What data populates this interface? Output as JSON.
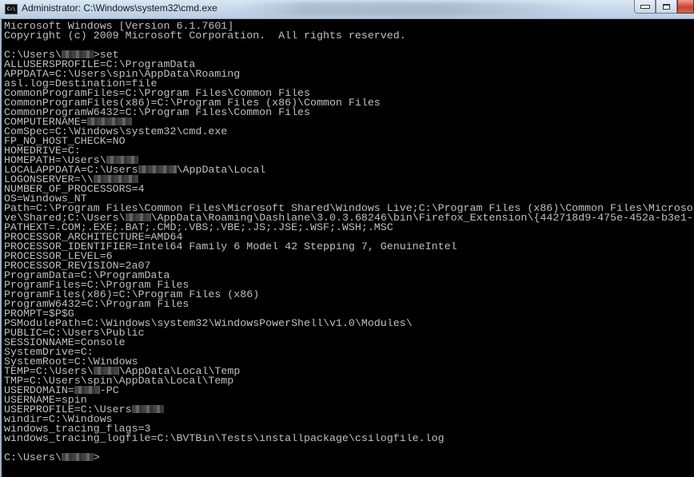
{
  "window": {
    "title": "Administrator: C:\\Windows\\system32\\cmd.exe",
    "icon": "cmd-icon",
    "buttons": [
      "minimize",
      "maximize",
      "close"
    ]
  },
  "console": {
    "lines": [
      {
        "text": "Microsoft Windows [Version 6.1.7601]"
      },
      {
        "text": "Copyright (c) 2009 Microsoft Corporation.  All rights reserved."
      },
      {
        "text": ""
      },
      {
        "text": "C:\\Users\\",
        "redacted": 5,
        "after": ">set"
      },
      {
        "text": "ALLUSERSPROFILE=C:\\ProgramData"
      },
      {
        "text": "APPDATA=C:\\Users\\spin\\AppData\\Roaming"
      },
      {
        "text": "asl.log=Destination=file"
      },
      {
        "text": "CommonProgramFiles=C:\\Program Files\\Common Files"
      },
      {
        "text": "CommonProgramFiles(x86)=C:\\Program Files (x86)\\Common Files"
      },
      {
        "text": "CommonProgramW6432=C:\\Program Files\\Common Files"
      },
      {
        "text": "COMPUTERNAME=",
        "redacted": 7,
        "after": ""
      },
      {
        "text": "ComSpec=C:\\Windows\\system32\\cmd.exe"
      },
      {
        "text": "FP_NO_HOST_CHECK=NO"
      },
      {
        "text": "HOMEDRIVE=C:"
      },
      {
        "text": "HOMEPATH=\\Users\\",
        "redacted": 5,
        "after": ""
      },
      {
        "text": "LOCALAPPDATA=C:\\Users",
        "redacted": 6,
        "after": "\\AppData\\Local"
      },
      {
        "text": "LOGONSERVER=\\\\",
        "redacted": 7,
        "after": ""
      },
      {
        "text": "NUMBER_OF_PROCESSORS=4"
      },
      {
        "text": "OS=Windows_NT"
      },
      {
        "text": "Path=C:\\Program Files\\Common Files\\Microsoft Shared\\Windows Live;C:\\Program Files (x86)\\Common Files\\Microso"
      },
      {
        "text": "ve\\Shared;C:\\Users\\",
        "redacted": 4,
        "after": "\\AppData\\Roaming\\Dashlane\\3.0.3.68246\\bin\\Firefox_Extension\\{442718d9-475e-452a-b3e1-"
      },
      {
        "text": "PATHEXT=.COM;.EXE;.BAT;.CMD;.VBS;.VBE;.JS;.JSE;.WSF;.WSH;.MSC"
      },
      {
        "text": "PROCESSOR_ARCHITECTURE=AMD64"
      },
      {
        "text": "PROCESSOR_IDENTIFIER=Intel64 Family 6 Model 42 Stepping 7, GenuineIntel"
      },
      {
        "text": "PROCESSOR_LEVEL=6"
      },
      {
        "text": "PROCESSOR_REVISION=2a07"
      },
      {
        "text": "ProgramData=C:\\ProgramData"
      },
      {
        "text": "ProgramFiles=C:\\Program Files"
      },
      {
        "text": "ProgramFiles(x86)=C:\\Program Files (x86)"
      },
      {
        "text": "ProgramW6432=C:\\Program Files"
      },
      {
        "text": "PROMPT=$P$G"
      },
      {
        "text": "PSModulePath=C:\\Windows\\system32\\WindowsPowerShell\\v1.0\\Modules\\"
      },
      {
        "text": "PUBLIC=C:\\Users\\Public"
      },
      {
        "text": "SESSIONNAME=Console"
      },
      {
        "text": "SystemDrive=C:"
      },
      {
        "text": "SystemRoot=C:\\Windows"
      },
      {
        "text": "TEMP=C:\\Users\\",
        "redacted": 4,
        "after": "\\AppData\\Local\\Temp"
      },
      {
        "text": "TMP=C:\\Users\\spin\\AppData\\Local\\Temp"
      },
      {
        "text": "USERDOMAIN=",
        "redacted": 4,
        "after": "-PC"
      },
      {
        "text": "USERNAME=spin"
      },
      {
        "text": "USERPROFILE=C:\\Users",
        "redacted": 5,
        "after": ""
      },
      {
        "text": "windir=C:\\Windows"
      },
      {
        "text": "windows_tracing_flags=3"
      },
      {
        "text": "windows_tracing_logfile=C:\\BVTBin\\Tests\\installpackage\\csilogfile.log"
      },
      {
        "text": ""
      },
      {
        "text": "C:\\Users\\",
        "redacted": 5,
        "after": ">"
      }
    ]
  }
}
